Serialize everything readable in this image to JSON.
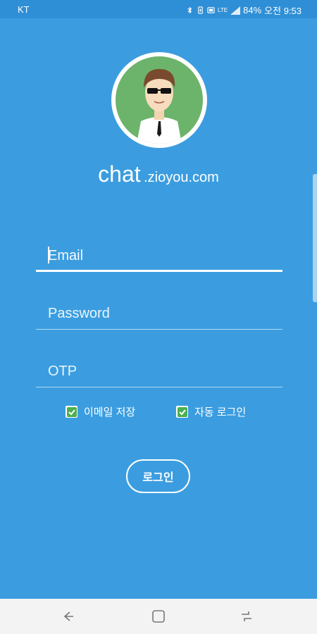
{
  "status_bar": {
    "carrier": "KT",
    "battery": "84%",
    "time": "오전 9:53",
    "network": "LTE"
  },
  "app": {
    "brand_main": "chat",
    "brand_sub": ".zioyou.com"
  },
  "form": {
    "email_placeholder": "Email",
    "password_placeholder": "Password",
    "otp_placeholder": "OTP"
  },
  "options": {
    "save_email_label": "이메일 저장",
    "save_email_checked": true,
    "auto_login_label": "자동 로그인",
    "auto_login_checked": true
  },
  "login_button": {
    "label": "로그인"
  },
  "colors": {
    "background": "#3b9de0",
    "status_bar": "#2f8fd6",
    "avatar_bg": "#6cb36b",
    "check_green": "#4caf50",
    "nav_bar": "#f3f3f3"
  },
  "icons": {
    "bluetooth": "bluetooth-icon",
    "signal": "signal-icon",
    "back": "back-icon",
    "home": "home-icon",
    "recents": "recents-icon",
    "check": "check-icon"
  }
}
